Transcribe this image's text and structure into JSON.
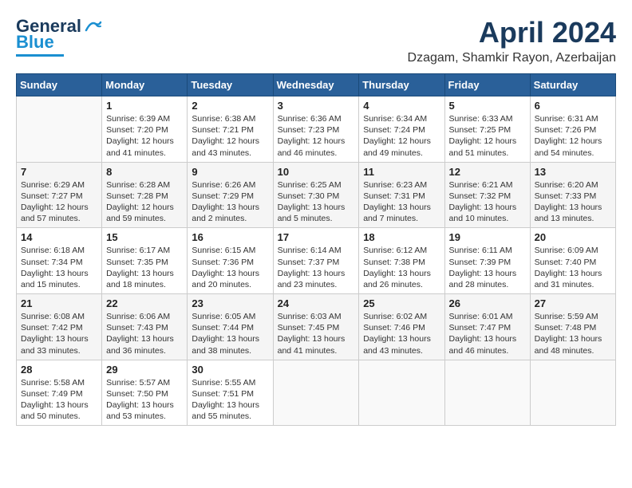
{
  "header": {
    "logo_general": "General",
    "logo_blue": "Blue",
    "title": "April 2024",
    "location": "Dzagam, Shamkir Rayon, Azerbaijan"
  },
  "columns": [
    "Sunday",
    "Monday",
    "Tuesday",
    "Wednesday",
    "Thursday",
    "Friday",
    "Saturday"
  ],
  "weeks": [
    [
      {
        "day": "",
        "info": ""
      },
      {
        "day": "1",
        "info": "Sunrise: 6:39 AM\nSunset: 7:20 PM\nDaylight: 12 hours\nand 41 minutes."
      },
      {
        "day": "2",
        "info": "Sunrise: 6:38 AM\nSunset: 7:21 PM\nDaylight: 12 hours\nand 43 minutes."
      },
      {
        "day": "3",
        "info": "Sunrise: 6:36 AM\nSunset: 7:23 PM\nDaylight: 12 hours\nand 46 minutes."
      },
      {
        "day": "4",
        "info": "Sunrise: 6:34 AM\nSunset: 7:24 PM\nDaylight: 12 hours\nand 49 minutes."
      },
      {
        "day": "5",
        "info": "Sunrise: 6:33 AM\nSunset: 7:25 PM\nDaylight: 12 hours\nand 51 minutes."
      },
      {
        "day": "6",
        "info": "Sunrise: 6:31 AM\nSunset: 7:26 PM\nDaylight: 12 hours\nand 54 minutes."
      }
    ],
    [
      {
        "day": "7",
        "info": "Sunrise: 6:29 AM\nSunset: 7:27 PM\nDaylight: 12 hours\nand 57 minutes."
      },
      {
        "day": "8",
        "info": "Sunrise: 6:28 AM\nSunset: 7:28 PM\nDaylight: 12 hours\nand 59 minutes."
      },
      {
        "day": "9",
        "info": "Sunrise: 6:26 AM\nSunset: 7:29 PM\nDaylight: 13 hours\nand 2 minutes."
      },
      {
        "day": "10",
        "info": "Sunrise: 6:25 AM\nSunset: 7:30 PM\nDaylight: 13 hours\nand 5 minutes."
      },
      {
        "day": "11",
        "info": "Sunrise: 6:23 AM\nSunset: 7:31 PM\nDaylight: 13 hours\nand 7 minutes."
      },
      {
        "day": "12",
        "info": "Sunrise: 6:21 AM\nSunset: 7:32 PM\nDaylight: 13 hours\nand 10 minutes."
      },
      {
        "day": "13",
        "info": "Sunrise: 6:20 AM\nSunset: 7:33 PM\nDaylight: 13 hours\nand 13 minutes."
      }
    ],
    [
      {
        "day": "14",
        "info": "Sunrise: 6:18 AM\nSunset: 7:34 PM\nDaylight: 13 hours\nand 15 minutes."
      },
      {
        "day": "15",
        "info": "Sunrise: 6:17 AM\nSunset: 7:35 PM\nDaylight: 13 hours\nand 18 minutes."
      },
      {
        "day": "16",
        "info": "Sunrise: 6:15 AM\nSunset: 7:36 PM\nDaylight: 13 hours\nand 20 minutes."
      },
      {
        "day": "17",
        "info": "Sunrise: 6:14 AM\nSunset: 7:37 PM\nDaylight: 13 hours\nand 23 minutes."
      },
      {
        "day": "18",
        "info": "Sunrise: 6:12 AM\nSunset: 7:38 PM\nDaylight: 13 hours\nand 26 minutes."
      },
      {
        "day": "19",
        "info": "Sunrise: 6:11 AM\nSunset: 7:39 PM\nDaylight: 13 hours\nand 28 minutes."
      },
      {
        "day": "20",
        "info": "Sunrise: 6:09 AM\nSunset: 7:40 PM\nDaylight: 13 hours\nand 31 minutes."
      }
    ],
    [
      {
        "day": "21",
        "info": "Sunrise: 6:08 AM\nSunset: 7:42 PM\nDaylight: 13 hours\nand 33 minutes."
      },
      {
        "day": "22",
        "info": "Sunrise: 6:06 AM\nSunset: 7:43 PM\nDaylight: 13 hours\nand 36 minutes."
      },
      {
        "day": "23",
        "info": "Sunrise: 6:05 AM\nSunset: 7:44 PM\nDaylight: 13 hours\nand 38 minutes."
      },
      {
        "day": "24",
        "info": "Sunrise: 6:03 AM\nSunset: 7:45 PM\nDaylight: 13 hours\nand 41 minutes."
      },
      {
        "day": "25",
        "info": "Sunrise: 6:02 AM\nSunset: 7:46 PM\nDaylight: 13 hours\nand 43 minutes."
      },
      {
        "day": "26",
        "info": "Sunrise: 6:01 AM\nSunset: 7:47 PM\nDaylight: 13 hours\nand 46 minutes."
      },
      {
        "day": "27",
        "info": "Sunrise: 5:59 AM\nSunset: 7:48 PM\nDaylight: 13 hours\nand 48 minutes."
      }
    ],
    [
      {
        "day": "28",
        "info": "Sunrise: 5:58 AM\nSunset: 7:49 PM\nDaylight: 13 hours\nand 50 minutes."
      },
      {
        "day": "29",
        "info": "Sunrise: 5:57 AM\nSunset: 7:50 PM\nDaylight: 13 hours\nand 53 minutes."
      },
      {
        "day": "30",
        "info": "Sunrise: 5:55 AM\nSunset: 7:51 PM\nDaylight: 13 hours\nand 55 minutes."
      },
      {
        "day": "",
        "info": ""
      },
      {
        "day": "",
        "info": ""
      },
      {
        "day": "",
        "info": ""
      },
      {
        "day": "",
        "info": ""
      }
    ]
  ]
}
